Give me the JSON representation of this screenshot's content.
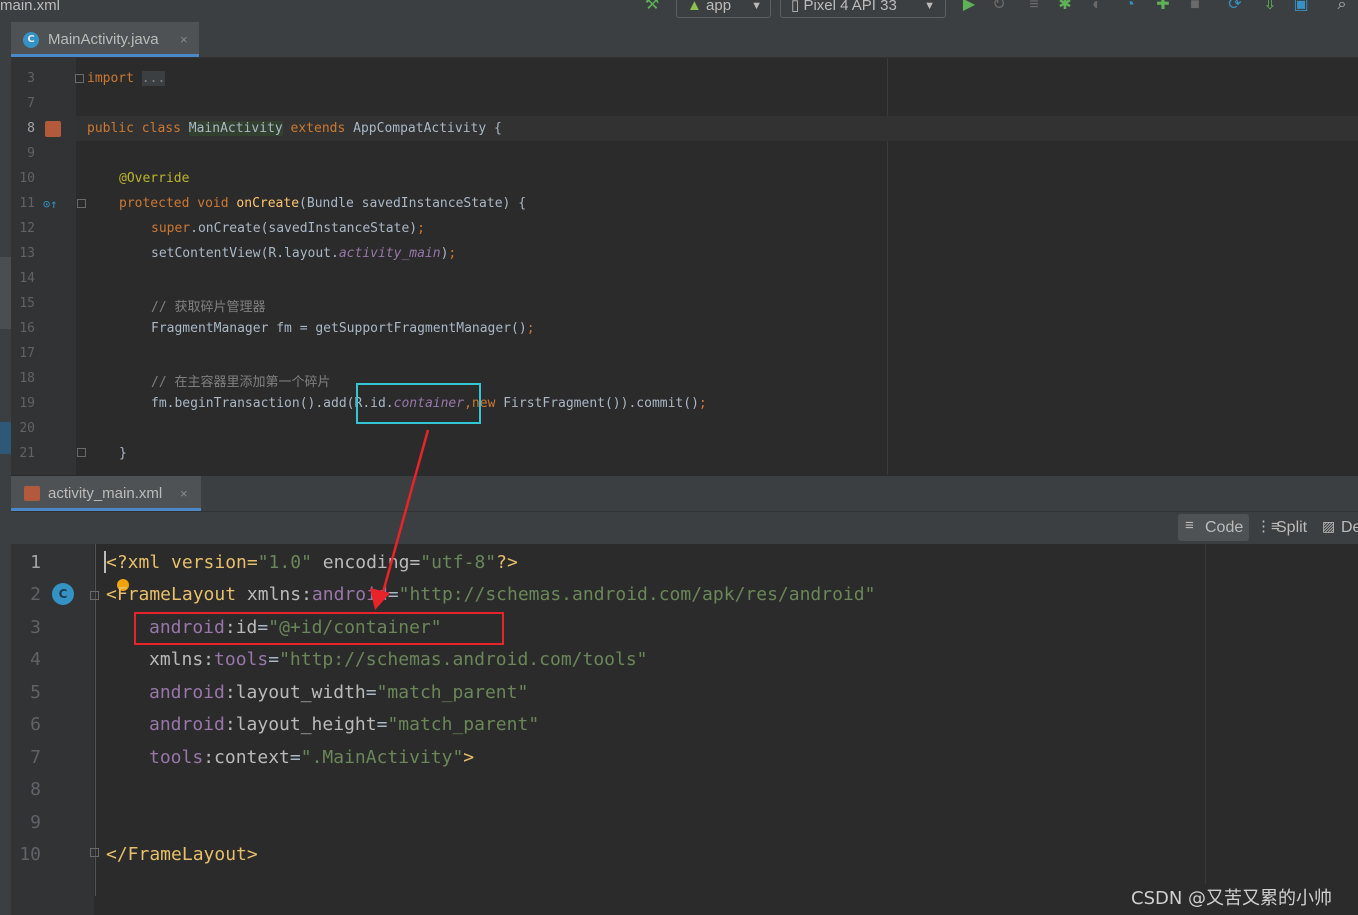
{
  "toolbar": {
    "breadcrumb": "main.xml",
    "run_config": "app",
    "device": "Pixel 4 API 33",
    "icons": [
      "hammer-icon",
      "android-icon",
      "device-icon",
      "run-icon",
      "rerun-icon",
      "rerun-tests-icon",
      "debug-icon",
      "attach-icon",
      "profile-icon",
      "apply-changes-icon",
      "stop-icon",
      "sync-icon",
      "sdk-manager-icon",
      "device-manager-icon",
      "search-icon"
    ]
  },
  "java_tab": {
    "label": "MainActivity.java",
    "icon_letter": "C",
    "close": "×"
  },
  "java_editor": {
    "lines": [
      {
        "n": "3"
      },
      {
        "n": "7"
      },
      {
        "n": "8"
      },
      {
        "n": "9"
      },
      {
        "n": "10"
      },
      {
        "n": "11"
      },
      {
        "n": "12"
      },
      {
        "n": "13"
      },
      {
        "n": "14"
      },
      {
        "n": "15"
      },
      {
        "n": "16"
      },
      {
        "n": "17"
      },
      {
        "n": "18"
      },
      {
        "n": "19"
      },
      {
        "n": "20"
      },
      {
        "n": "21"
      }
    ],
    "import_kw": "import",
    "import_dots": "...",
    "class_public": "public",
    "class_kw": "class",
    "class_name": "MainActivity",
    "extends_kw": "extends",
    "parent_class": "AppCompatActivity",
    "brace_open": "{",
    "override": "@Override",
    "protected": "protected",
    "void": "void",
    "oncreate": "onCreate",
    "oncreate_params": "(Bundle savedInstanceState) {",
    "super_kw": "super",
    "super_call": ".onCreate(savedInstanceState)",
    "semicolon": ";",
    "setcontent_a": "setContentView(R.layout.",
    "setcontent_b": "activity_main",
    "setcontent_c": ")",
    "comment1": "// 获取碎片管理器",
    "fm_line": "FragmentManager fm = getSupportFragmentManager()",
    "comment2": "// 在主容器里添加第一个碎片",
    "tx_a": "fm.beginTransaction().add(",
    "tx_b": "R.id.",
    "tx_c": "container",
    "tx_d": ",",
    "tx_new": "new",
    "tx_e": " FirstFragment()).commit()",
    "close_brace": "}"
  },
  "xml_tab": {
    "label": "activity_main.xml",
    "close": "×"
  },
  "view_modes": {
    "code": "Code",
    "split": "Split",
    "design": "De"
  },
  "xml_editor": {
    "lines": [
      "1",
      "2",
      "3",
      "4",
      "5",
      "6",
      "7",
      "8",
      "9",
      "10"
    ],
    "decl_a": "<?xml version=",
    "decl_ver": "\"1.0\"",
    "decl_b": " encoding=",
    "decl_enc": "\"utf-8\"",
    "decl_c": "?>",
    "fl_open": "<FrameLayout ",
    "xmlns_a": "xmlns:",
    "android": "android",
    "eq": "=",
    "android_ns": "\"http://schemas.android.com/apk/res/android\"",
    "id_attr": "id",
    "id_val": "\"@+id/container\"",
    "tools": "tools",
    "tools_ns": "\"http://schemas.android.com/tools\"",
    "lw_attr": "layout_width",
    "lw_val": "\"match_parent\"",
    "lh_attr": "layout_height",
    "lh_val": "\"match_parent\"",
    "ctx_attr": "context",
    "ctx_val": "\".MainActivity\"",
    "gt": ">",
    "fl_close": "</FrameLayout>",
    "colon": ":"
  },
  "watermark": "CSDN @又苦又累的小帅",
  "colors": {
    "annotation_red": "#e8232a",
    "annotation_cyan": "#35c6d6",
    "tab_accent": "#4a88c7"
  }
}
